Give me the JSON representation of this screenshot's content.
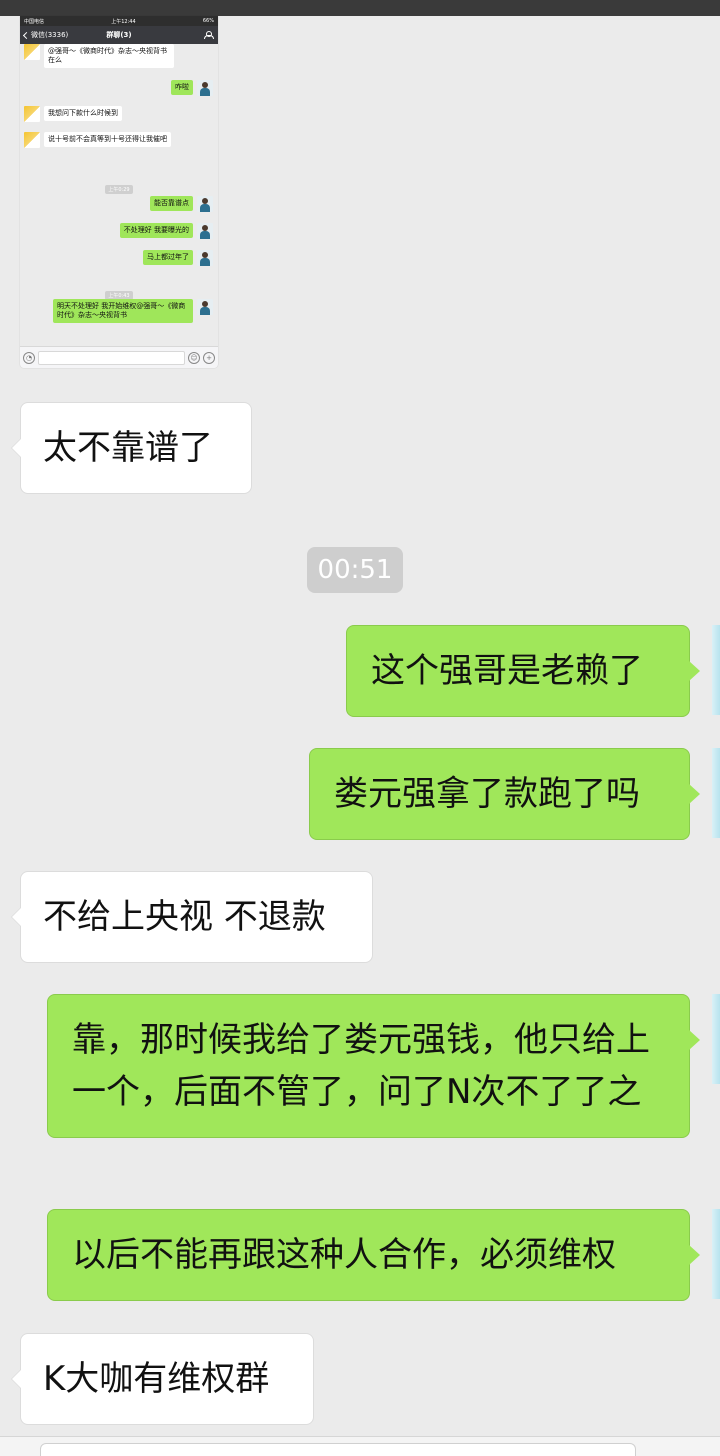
{
  "embedded_screenshot": {
    "status_bar": {
      "carrier": "中国电信",
      "time": "上午12:44",
      "battery": "66%"
    },
    "nav": {
      "back_label": "微信(3336)",
      "title": "群聊(3)"
    },
    "messages": [
      {
        "side": "left",
        "text": "@强哥～《微商时代》杂志～央视背书 在么"
      },
      {
        "side": "right",
        "text": "咋啦"
      },
      {
        "side": "left",
        "text": "我想问下款什么时候到"
      },
      {
        "side": "left",
        "text": "说十号前不会真等到十号还得让我催吧"
      },
      {
        "side": "time",
        "text": "上午0:29"
      },
      {
        "side": "right",
        "text": "能否靠谱点"
      },
      {
        "side": "right",
        "text": "不处理好 我要曝光的"
      },
      {
        "side": "right",
        "text": "马上都过年了"
      },
      {
        "side": "time",
        "text": "上午0:43"
      },
      {
        "side": "right",
        "text": "明天不处理好 我开始维权@强哥～《微商时代》杂志～央视背书"
      }
    ]
  },
  "chat": {
    "msg1": "太不靠谱了",
    "timestamp": "00:51",
    "msg2": "这个强哥是老赖了",
    "msg3": "娄元强拿了款跑了吗",
    "msg4": "不给上央视 不退款",
    "msg5": "靠，那时候我给了娄元强钱，他只给上一个，后面不管了，问了N次不了了之",
    "msg6": "以后不能再跟这种人合作，必须维权",
    "msg7": "K大咖有维权群"
  },
  "colors": {
    "sent_bubble": "#a0e75a",
    "received_bubble": "#ffffff",
    "background": "#ebebeb"
  }
}
